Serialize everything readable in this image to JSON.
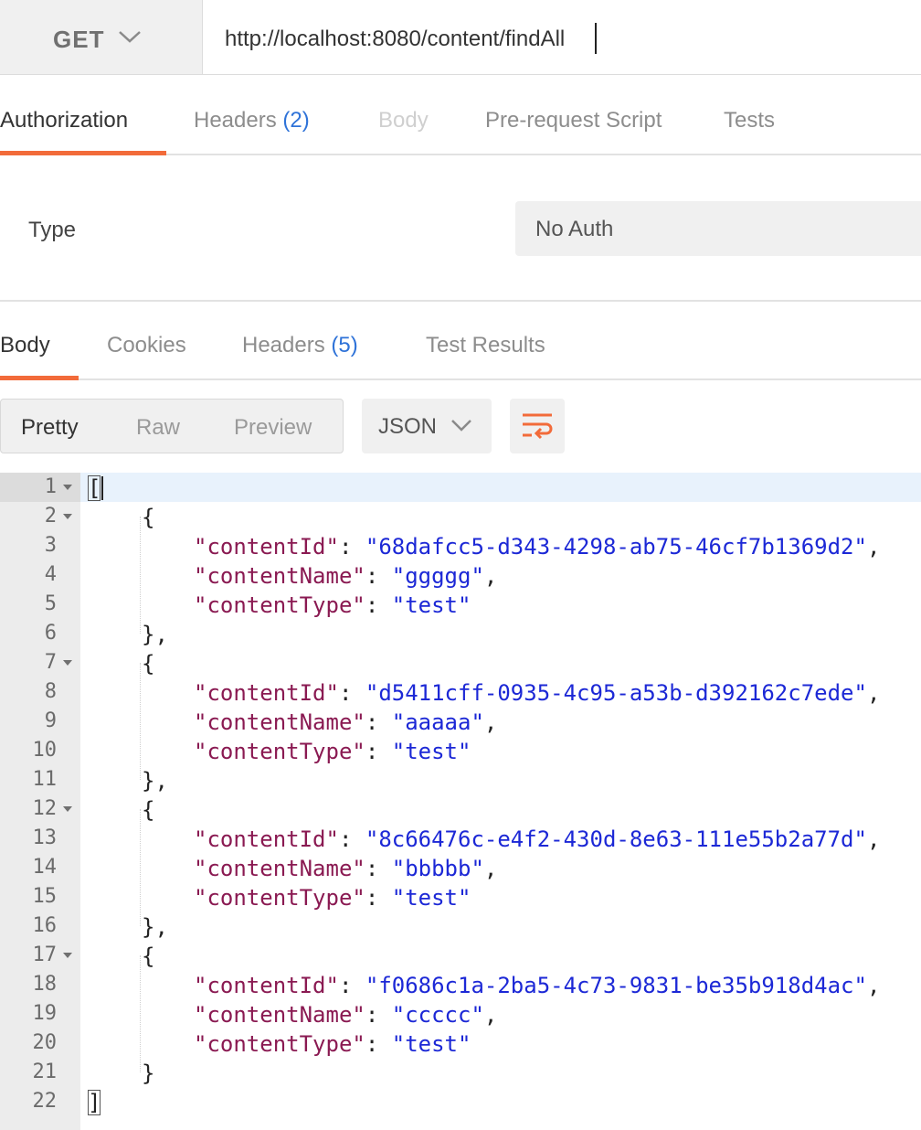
{
  "request": {
    "method": "GET",
    "url": "http://localhost:8080/content/findAll"
  },
  "request_tabs": {
    "authorization": "Authorization",
    "headers": "Headers",
    "headers_count": "(2)",
    "body": "Body",
    "prerequest": "Pre-request Script",
    "tests": "Tests"
  },
  "auth": {
    "type_label": "Type",
    "type_value": "No Auth"
  },
  "response_tabs": {
    "body": "Body",
    "cookies": "Cookies",
    "headers": "Headers",
    "headers_count": "(5)",
    "test_results": "Test Results"
  },
  "view_modes": {
    "pretty": "Pretty",
    "raw": "Raw",
    "preview": "Preview",
    "format": "JSON"
  },
  "icons": {
    "method_dropdown": "chevron-down-icon",
    "format_dropdown": "chevron-down-icon",
    "wrap": "wrap-lines-icon"
  },
  "colors": {
    "accent": "#f26b3a",
    "link_count": "#2f73d8",
    "json_key": "#8a1a52",
    "json_string": "#1c28d6"
  },
  "response_body": {
    "line_numbers": [
      "1",
      "2",
      "3",
      "4",
      "5",
      "6",
      "7",
      "8",
      "9",
      "10",
      "11",
      "12",
      "13",
      "14",
      "15",
      "16",
      "17",
      "18",
      "19",
      "20",
      "21",
      "22"
    ],
    "items": [
      {
        "contentId": "68dafcc5-d343-4298-ab75-46cf7b1369d2",
        "contentName": "ggggg",
        "contentType": "test"
      },
      {
        "contentId": "d5411cff-0935-4c95-a53b-d392162c7ede",
        "contentName": "aaaaa",
        "contentType": "test"
      },
      {
        "contentId": "8c66476c-e4f2-430d-8e63-111e55b2a77d",
        "contentName": "bbbbb",
        "contentType": "test"
      },
      {
        "contentId": "f0686c1a-2ba5-4c73-9831-be35b918d4ac",
        "contentName": "ccccc",
        "contentType": "test"
      }
    ],
    "keys": {
      "id": "\"contentId\"",
      "name": "\"contentName\"",
      "type": "\"contentType\""
    }
  }
}
